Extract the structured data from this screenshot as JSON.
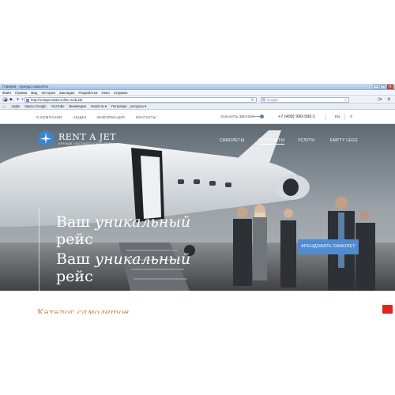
{
  "browser": {
    "window_title": "Главная - Аренда самолета",
    "menu": [
      "Файл",
      "Правка",
      "Вид",
      "История",
      "Закладки",
      "Разработка",
      "Окно",
      "Справка"
    ],
    "url": "http://rentajet.ahab.online.ru/3L26/",
    "search_placeholder": "Google",
    "bookmarks": [
      "Apple",
      "Карты Google",
      "YouTube",
      "Википедия",
      "Новости ▾",
      "Популярн... ресурсы ▾"
    ]
  },
  "site": {
    "topnav": [
      "О КОМПАНИИ",
      "АКЦИИ",
      "ИНФОРМАЦИЯ",
      "КОНТАКТЫ"
    ],
    "callback": "ЗАКАЗАТЬ ЗВОНОК",
    "phone": "+7 (499) 990-990-1",
    "lang": "EN",
    "logo_text": "RENT A JET",
    "logo_sub": "АРЕНДА ЧАСТНОГО САМОЛЕТА",
    "hero_menu": [
      "САМОЛЕТЫ",
      "ВЕРТОЛЕТЫ",
      "УСЛУГИ",
      "EMPTY LEGS"
    ],
    "hero_title_1_plain": "Ваш ",
    "hero_title_1_italic": "уникальный",
    "hero_title_2": "рейс",
    "cta": "АРЕНДОВАТЬ САМОЛЕТ",
    "catalog_plain": "Каталог ",
    "catalog_italic": "самолетов"
  },
  "colors": {
    "accent": "#4f8bd0",
    "catalog": "#bf8a45",
    "chat": "#e2231a"
  }
}
